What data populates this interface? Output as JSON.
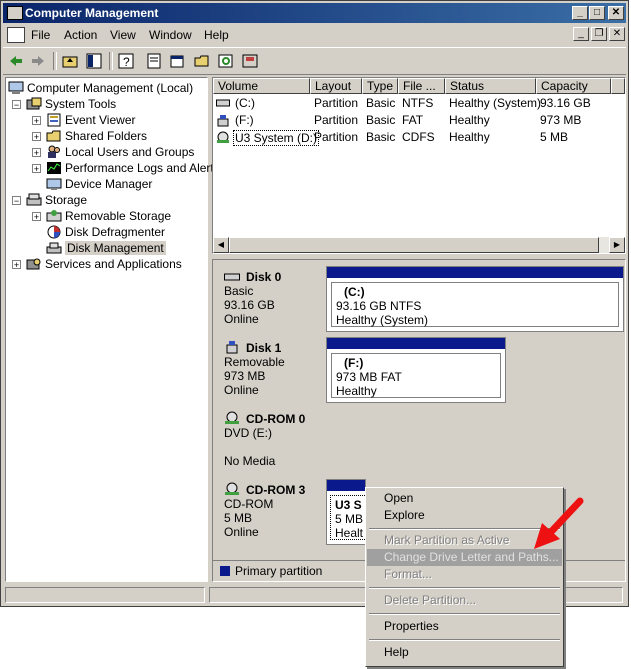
{
  "window": {
    "title": "Computer Management"
  },
  "menu": {
    "items": [
      "File",
      "Action",
      "View",
      "Window",
      "Help"
    ]
  },
  "tree": {
    "root": "Computer Management (Local)",
    "items": [
      {
        "label": "System Tools"
      },
      {
        "label": "Event Viewer"
      },
      {
        "label": "Shared Folders"
      },
      {
        "label": "Local Users and Groups"
      },
      {
        "label": "Performance Logs and Alerts"
      },
      {
        "label": "Device Manager"
      },
      {
        "label": "Storage"
      },
      {
        "label": "Removable Storage"
      },
      {
        "label": "Disk Defragmenter"
      },
      {
        "label": "Disk Management"
      },
      {
        "label": "Services and Applications"
      }
    ]
  },
  "volumes": {
    "headers": [
      "Volume",
      "Layout",
      "Type",
      "File ...",
      "Status",
      "Capacity"
    ],
    "rows": [
      {
        "volume": "(C:)",
        "layout": "Partition",
        "type": "Basic",
        "fs": "NTFS",
        "status": "Healthy (System)",
        "capacity": "93.16 GB"
      },
      {
        "volume": "(F:)",
        "layout": "Partition",
        "type": "Basic",
        "fs": "FAT",
        "status": "Healthy",
        "capacity": "973 MB"
      },
      {
        "volume": "U3 System (D:)",
        "layout": "Partition",
        "type": "Basic",
        "fs": "CDFS",
        "status": "Healthy",
        "capacity": "5 MB"
      }
    ]
  },
  "disks": [
    {
      "name": "Disk 0",
      "line1": "Basic",
      "line2": "93.16 GB",
      "line3": "Online",
      "part": {
        "title": "(C:)",
        "detail": "93.16 GB NTFS",
        "status": "Healthy (System)"
      }
    },
    {
      "name": "Disk 1",
      "line1": "Removable",
      "line2": "973 MB",
      "line3": "Online",
      "part": {
        "title": "(F:)",
        "detail": "973 MB FAT",
        "status": "Healthy"
      }
    },
    {
      "name": "CD-ROM 0",
      "line1": "DVD (E:)",
      "line2": "",
      "line3": "No Media"
    },
    {
      "name": "CD-ROM 3",
      "line1": "CD-ROM",
      "line2": "5 MB",
      "line3": "Online",
      "part": {
        "title": "U3 S",
        "detail": "5 MB",
        "status": "Healt"
      }
    }
  ],
  "legend": {
    "label": "Primary partition",
    "color": "#0a1a8c"
  },
  "context_menu": {
    "items": [
      {
        "label": "Open",
        "enabled": true
      },
      {
        "label": "Explore",
        "enabled": true
      },
      {
        "label": "Mark Partition as Active",
        "enabled": false
      },
      {
        "label": "Change Drive Letter and Paths...",
        "enabled": false,
        "highlighted": true
      },
      {
        "label": "Format...",
        "enabled": false
      },
      {
        "label": "Delete Partition...",
        "enabled": false
      },
      {
        "label": "Properties",
        "enabled": true
      },
      {
        "label": "Help",
        "enabled": true
      }
    ]
  },
  "colors": {
    "titlebar": "#0a246a",
    "arrow": "#ee1111"
  }
}
